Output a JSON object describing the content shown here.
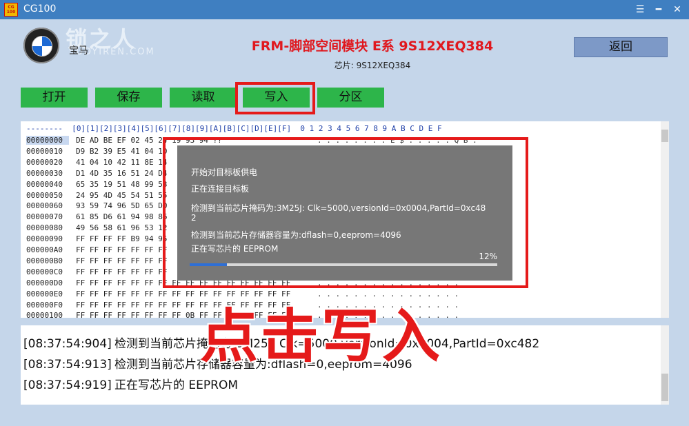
{
  "window": {
    "title": "CG100",
    "logo_line1": "CG",
    "logo_line2": "100",
    "menu_icon": "☰",
    "minimize_icon": "━",
    "close_icon": "✕"
  },
  "watermark": {
    "name": "锁之人",
    "site": "SUOYIREN.COM"
  },
  "header": {
    "brand": "宝马",
    "module_title": "FRM-脚部空间模块 E系 9S12XEQ384",
    "chip_info": "芯片: 9S12XEQ384",
    "back_label": "返回"
  },
  "toolbar": {
    "open": "打开",
    "save": "保存",
    "read": "读取",
    "write": "写入",
    "partition": "分区"
  },
  "hex_view": {
    "header": "--------  [0][1][2][3][4][5][6][7][8][9][A][B][C][D][E][F]  0 1 2 3 4 5 6 7 8 9 A B C D E F",
    "rows": [
      {
        "addr": "00000000",
        "bytes": "DE AD BE EF 02 45 24 19 93 94 ??",
        "ascii": ". . . . . . . . E $ . . . . . Q B ."
      },
      {
        "addr": "00000010",
        "bytes": "D9 B2 39 E5 41 04 10",
        "ascii": ""
      },
      {
        "addr": "00000020",
        "bytes": "41 04 10 42 11 8E 14",
        "ascii": ""
      },
      {
        "addr": "00000030",
        "bytes": "D1 4D 35 16 51 24 D4",
        "ascii": ""
      },
      {
        "addr": "00000040",
        "bytes": "65 35 19 51 48 99 53",
        "ascii": ""
      },
      {
        "addr": "00000050",
        "bytes": "24 95 4D 45 54 51 55",
        "ascii": ""
      },
      {
        "addr": "00000060",
        "bytes": "93 59 74 96 5D 65 D0",
        "ascii": ""
      },
      {
        "addr": "00000070",
        "bytes": "61 85 D6 61 94 98 86",
        "ascii": ""
      },
      {
        "addr": "00000080",
        "bytes": "49 56 58 61 96 53 12",
        "ascii": ""
      },
      {
        "addr": "00000090",
        "bytes": "FF FF FF FF B9 94 95",
        "ascii": ""
      },
      {
        "addr": "000000A0",
        "bytes": "FF FF FF FF FF FF FF",
        "ascii": ""
      },
      {
        "addr": "000000B0",
        "bytes": "FF FF FF FF FF FF FF",
        "ascii": ""
      },
      {
        "addr": "000000C0",
        "bytes": "FF FF FF FF FF FF FF",
        "ascii": ""
      },
      {
        "addr": "000000D0",
        "bytes": "FF FF FF FF FF FF FF FF FF FF FF FF FF FF FF FF",
        "ascii": ". . . . . . . . . . . . . . . ."
      },
      {
        "addr": "000000E0",
        "bytes": "FF FF FF FF FF FF FF FF FF FF FF FF FF FF FF FF",
        "ascii": ". . . . . . . . . . . . . . . ."
      },
      {
        "addr": "000000F0",
        "bytes": "FF FF FF FF FF FF FF FF FF FF FF FF FF FF FF FF",
        "ascii": ". . . . . . . . . . . . . . . ."
      },
      {
        "addr": "00000100",
        "bytes": "FF FF FF FF FF FF FF FF 0B FF FF FF FF FF FF FF",
        "ascii": ". . . . . . . . . . . . . . . ."
      }
    ]
  },
  "progress_dialog": {
    "lines": [
      "开始对目标板供电",
      "正在连接目标板",
      "检测到当前芯片掩码为:3M25J:  Clk=5000,versionId=0x0004,PartId=0xc48",
      "2",
      "检测到当前芯片存储器容量为:dflash=0,eeprom=4096",
      "正在写芯片的   EEPROM"
    ],
    "progress_label": "12%",
    "progress_percent": 12
  },
  "log": {
    "lines": [
      {
        "time": "[08:37:54:904]",
        "text": "检测到当前芯片掩码为:3M25J:  Clk=5000,versionId=0x0004,PartId=0xc482"
      },
      {
        "time": "[08:37:54:913]",
        "text": "检测到当前芯片存储器容量为:dflash=0,eeprom=4096"
      },
      {
        "time": "[08:37:54:919]",
        "text": "正在写芯片的   EEPROM"
      }
    ]
  },
  "callout": "点击写入",
  "colors": {
    "accent_red": "#e51a1a",
    "titlebar": "#3f7fc1",
    "toolbar_green": "#2db54a"
  }
}
